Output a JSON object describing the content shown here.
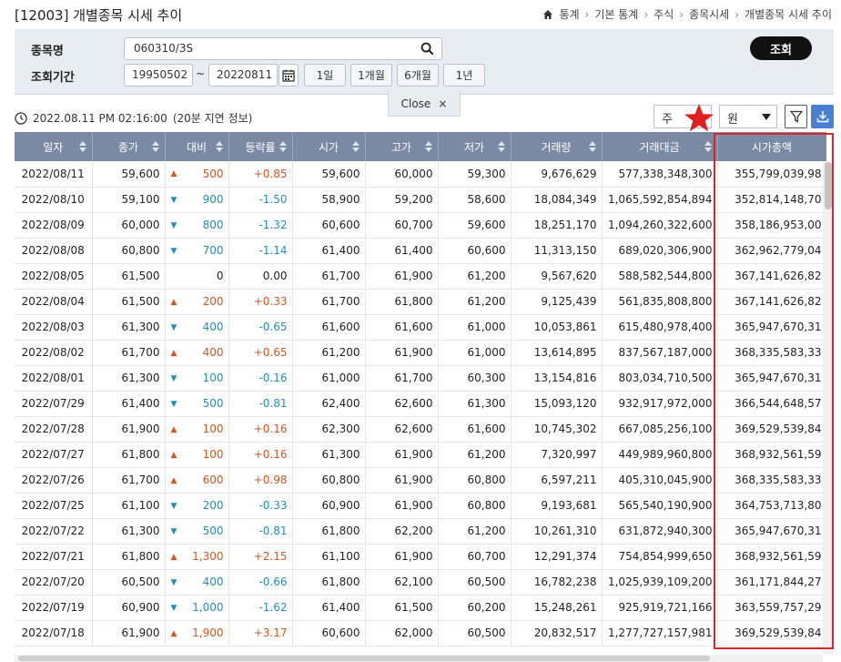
{
  "window": {
    "title": "[12003] 개별종목 시세 추이"
  },
  "breadcrumb": [
    "통계",
    "기본 통계",
    "주식",
    "종목시세",
    "개별종목 시세 추이"
  ],
  "search": {
    "code_label": "종목명",
    "code_value": "060310/3S",
    "period_label": "조회기간",
    "start_date": "19950502",
    "end_date": "20220811",
    "period_buttons": [
      "1일",
      "1개월",
      "6개월",
      "1년"
    ],
    "query_label": "조회",
    "close_label": "Close"
  },
  "toolbar": {
    "timestamp": "2022.08.11 PM 02:16:00",
    "delay_note": "(20분 지연 정보)",
    "freq_select": "주",
    "currency_select": "원",
    "filter_icon": "filter-icon",
    "download_icon": "download-icon"
  },
  "colors": {
    "header": "#7a8aa5",
    "up": "#d9541b",
    "down": "#1f8fc1",
    "highlight": "#d9262b",
    "query_btn": "#111111"
  },
  "table": {
    "columns": [
      "일자",
      "종가",
      "대비",
      "등락률",
      "시가",
      "고가",
      "저가",
      "거래량",
      "거래대금",
      "시가총액"
    ],
    "rows": [
      {
        "date": "2022/08/11",
        "close": "59,600",
        "dir": "up",
        "diff": "500",
        "rate": "+0.85",
        "open": "59,600",
        "high": "60,000",
        "low": "59,300",
        "vol": "9,676,629",
        "amount": "577,338,348,300",
        "mcap": "355,799,039,98"
      },
      {
        "date": "2022/08/10",
        "close": "59,100",
        "dir": "down",
        "diff": "900",
        "rate": "-1.50",
        "open": "58,900",
        "high": "59,200",
        "low": "58,600",
        "vol": "18,084,349",
        "amount": "1,065,592,854,894",
        "mcap": "352,814,148,70"
      },
      {
        "date": "2022/08/09",
        "close": "60,000",
        "dir": "down",
        "diff": "800",
        "rate": "-1.32",
        "open": "60,600",
        "high": "60,700",
        "low": "59,600",
        "vol": "18,251,170",
        "amount": "1,094,260,322,600",
        "mcap": "358,186,953,00"
      },
      {
        "date": "2022/08/08",
        "close": "60,800",
        "dir": "down",
        "diff": "700",
        "rate": "-1.14",
        "open": "61,400",
        "high": "61,400",
        "low": "60,600",
        "vol": "11,313,150",
        "amount": "689,020,306,900",
        "mcap": "362,962,779,04"
      },
      {
        "date": "2022/08/05",
        "close": "61,500",
        "dir": "flat",
        "diff": "0",
        "rate": "0.00",
        "open": "61,700",
        "high": "61,900",
        "low": "61,200",
        "vol": "9,567,620",
        "amount": "588,582,544,800",
        "mcap": "367,141,626,82"
      },
      {
        "date": "2022/08/04",
        "close": "61,500",
        "dir": "up",
        "diff": "200",
        "rate": "+0.33",
        "open": "61,700",
        "high": "61,800",
        "low": "61,200",
        "vol": "9,125,439",
        "amount": "561,835,808,800",
        "mcap": "367,141,626,82"
      },
      {
        "date": "2022/08/03",
        "close": "61,300",
        "dir": "down",
        "diff": "400",
        "rate": "-0.65",
        "open": "61,600",
        "high": "61,600",
        "low": "61,000",
        "vol": "10,053,861",
        "amount": "615,480,978,400",
        "mcap": "365,947,670,31"
      },
      {
        "date": "2022/08/02",
        "close": "61,700",
        "dir": "up",
        "diff": "400",
        "rate": "+0.65",
        "open": "61,200",
        "high": "61,900",
        "low": "61,000",
        "vol": "13,614,895",
        "amount": "837,567,187,000",
        "mcap": "368,335,583,33"
      },
      {
        "date": "2022/08/01",
        "close": "61,300",
        "dir": "down",
        "diff": "100",
        "rate": "-0.16",
        "open": "61,000",
        "high": "61,700",
        "low": "60,300",
        "vol": "13,154,816",
        "amount": "803,034,710,500",
        "mcap": "365,947,670,31"
      },
      {
        "date": "2022/07/29",
        "close": "61,400",
        "dir": "down",
        "diff": "500",
        "rate": "-0.81",
        "open": "62,400",
        "high": "62,600",
        "low": "61,300",
        "vol": "15,093,120",
        "amount": "932,917,972,000",
        "mcap": "366,544,648,57"
      },
      {
        "date": "2022/07/28",
        "close": "61,900",
        "dir": "up",
        "diff": "100",
        "rate": "+0.16",
        "open": "62,300",
        "high": "62,600",
        "low": "61,600",
        "vol": "10,745,302",
        "amount": "667,085,256,100",
        "mcap": "369,529,539,84"
      },
      {
        "date": "2022/07/27",
        "close": "61,800",
        "dir": "up",
        "diff": "100",
        "rate": "+0.16",
        "open": "61,300",
        "high": "61,900",
        "low": "61,200",
        "vol": "7,320,997",
        "amount": "449,989,960,800",
        "mcap": "368,932,561,59"
      },
      {
        "date": "2022/07/26",
        "close": "61,700",
        "dir": "up",
        "diff": "600",
        "rate": "+0.98",
        "open": "60,800",
        "high": "61,900",
        "low": "60,800",
        "vol": "6,597,211",
        "amount": "405,310,045,900",
        "mcap": "368,335,583,33"
      },
      {
        "date": "2022/07/25",
        "close": "61,100",
        "dir": "down",
        "diff": "200",
        "rate": "-0.33",
        "open": "60,900",
        "high": "61,900",
        "low": "60,800",
        "vol": "9,193,681",
        "amount": "565,540,190,900",
        "mcap": "364,753,713,80"
      },
      {
        "date": "2022/07/22",
        "close": "61,300",
        "dir": "down",
        "diff": "500",
        "rate": "-0.81",
        "open": "61,800",
        "high": "62,200",
        "low": "61,200",
        "vol": "10,261,310",
        "amount": "631,872,940,300",
        "mcap": "365,947,670,31"
      },
      {
        "date": "2022/07/21",
        "close": "61,800",
        "dir": "up",
        "diff": "1,300",
        "rate": "+2.15",
        "open": "61,100",
        "high": "61,900",
        "low": "60,700",
        "vol": "12,291,374",
        "amount": "754,854,999,650",
        "mcap": "368,932,561,59"
      },
      {
        "date": "2022/07/20",
        "close": "60,500",
        "dir": "down",
        "diff": "400",
        "rate": "-0.66",
        "open": "61,800",
        "high": "62,100",
        "low": "60,500",
        "vol": "16,782,238",
        "amount": "1,025,939,109,200",
        "mcap": "361,171,844,27"
      },
      {
        "date": "2022/07/19",
        "close": "60,900",
        "dir": "down",
        "diff": "1,000",
        "rate": "-1.62",
        "open": "61,400",
        "high": "61,500",
        "low": "60,200",
        "vol": "15,248,261",
        "amount": "925,919,721,166",
        "mcap": "363,559,757,29"
      },
      {
        "date": "2022/07/18",
        "close": "61,900",
        "dir": "up",
        "diff": "1,900",
        "rate": "+3.17",
        "open": "60,600",
        "high": "62,000",
        "low": "60,500",
        "vol": "20,832,517",
        "amount": "1,277,727,157,981",
        "mcap": "369,529,539,84"
      }
    ]
  }
}
